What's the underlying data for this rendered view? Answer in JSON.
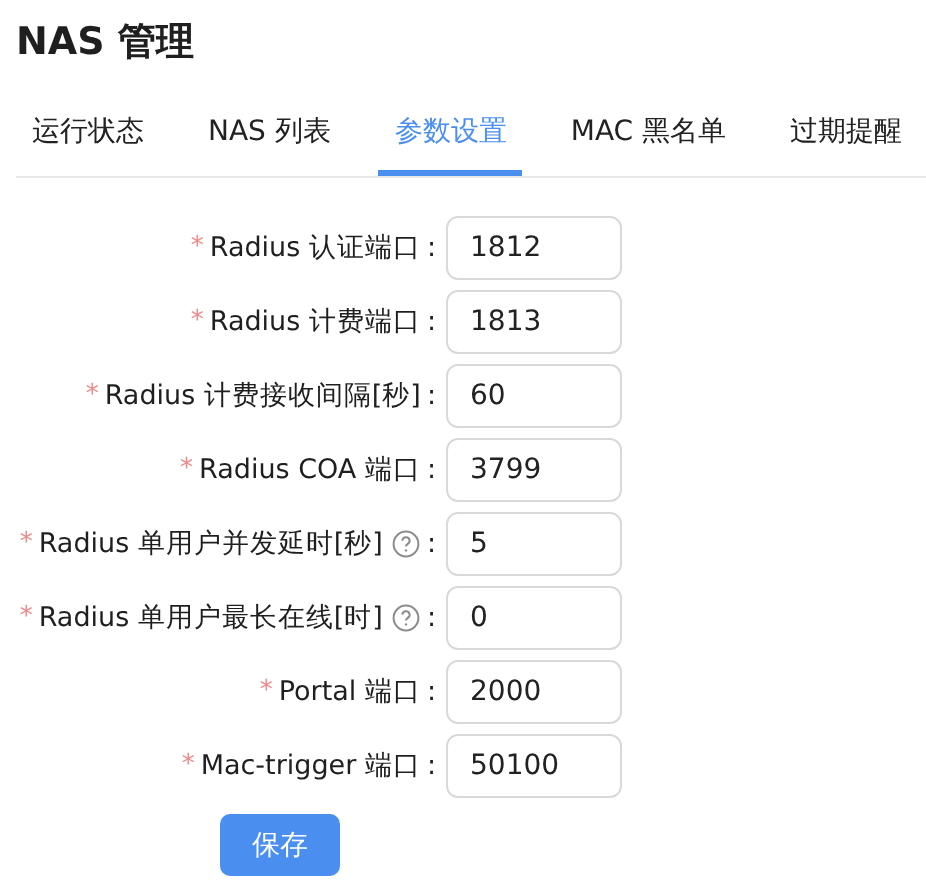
{
  "page": {
    "title": "NAS 管理"
  },
  "tabs": [
    {
      "label": "运行状态",
      "selected": false
    },
    {
      "label": "NAS 列表",
      "selected": false
    },
    {
      "label": "参数设置",
      "selected": true
    },
    {
      "label": "MAC 黑名单",
      "selected": false
    },
    {
      "label": "过期提醒",
      "selected": false
    }
  ],
  "form": {
    "fields": [
      {
        "required_mark": "*",
        "label": "Radius 认证端口",
        "help": false,
        "colon": ":",
        "value": "1812"
      },
      {
        "required_mark": "*",
        "label": "Radius 计费端口",
        "help": false,
        "colon": ":",
        "value": "1813"
      },
      {
        "required_mark": "*",
        "label": "Radius 计费接收间隔[秒]",
        "help": false,
        "colon": ":",
        "value": "60"
      },
      {
        "required_mark": "*",
        "label": "Radius COA 端口",
        "help": false,
        "colon": ":",
        "value": "3799"
      },
      {
        "required_mark": "*",
        "label": "Radius 单用户并发延时[秒]",
        "help": true,
        "colon": ":",
        "value": "5"
      },
      {
        "required_mark": "*",
        "label": "Radius 单用户最长在线[时]",
        "help": true,
        "colon": ":",
        "value": "0"
      },
      {
        "required_mark": "*",
        "label": "Portal 端口",
        "help": false,
        "colon": ":",
        "value": "2000"
      },
      {
        "required_mark": "*",
        "label": "Mac-trigger 端口",
        "help": false,
        "colon": ":",
        "value": "50100"
      }
    ],
    "submit": "保存"
  }
}
